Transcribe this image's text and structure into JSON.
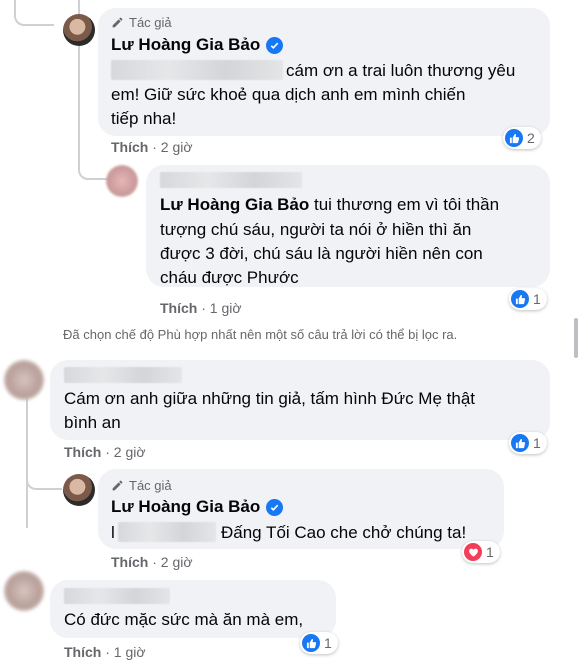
{
  "comments": [
    {
      "badge": "Tác giả",
      "name": "Lư Hoàng Gia Bảo",
      "lines": [
        "cám ơn a trai luôn thương yêu",
        "em! Giữ sức khoẻ qua dịch anh em mình chiến",
        "tiếp nha!"
      ],
      "like": "Thích",
      "time": "2 giờ",
      "reaction_icon": "like-icon",
      "reaction_count": "2"
    },
    {
      "tag_name": "Lư Hoàng Gia Bảo",
      "first_line_rest": " tui thương em vì tôi thần",
      "lines": [
        "tượng chú sáu, người ta nói ở hiền thì ăn",
        "được 3 đời, chú sáu là người hiền nên con",
        "cháu được Phước"
      ],
      "like": "Thích",
      "time": "1 giờ",
      "reaction_icon": "like-icon",
      "reaction_count": "1"
    },
    {
      "lines": [
        "Cám ơn anh giữa những tin giả, tấm hình Đức Mẹ thật",
        "bình an"
      ],
      "like": "Thích",
      "time": "2 giờ",
      "reaction_icon": "like-icon",
      "reaction_count": "1"
    },
    {
      "badge": "Tác giả",
      "name": "Lư Hoàng Gia Bảo",
      "prefix": "l",
      "lines": [
        "Đấng Tối Cao che chở chúng ta!"
      ],
      "like": "Thích",
      "time": "2 giờ",
      "reaction_icon": "heart-icon",
      "reaction_count": "1"
    },
    {
      "lines": [
        "Có đức mặc sức mà ăn mà em,"
      ],
      "like": "Thích",
      "time": "1 giờ",
      "reaction_icon": "like-icon",
      "reaction_count": "1"
    }
  ],
  "notice": "Đã chọn chế độ Phù hợp nhất nên một số câu trả lời có thể bị lọc ra.",
  "separator": "·",
  "colors": {
    "accent": "#1877f2",
    "heart": "#f33e58",
    "bubble": "#f0f2f5",
    "meta": "#65676b"
  }
}
